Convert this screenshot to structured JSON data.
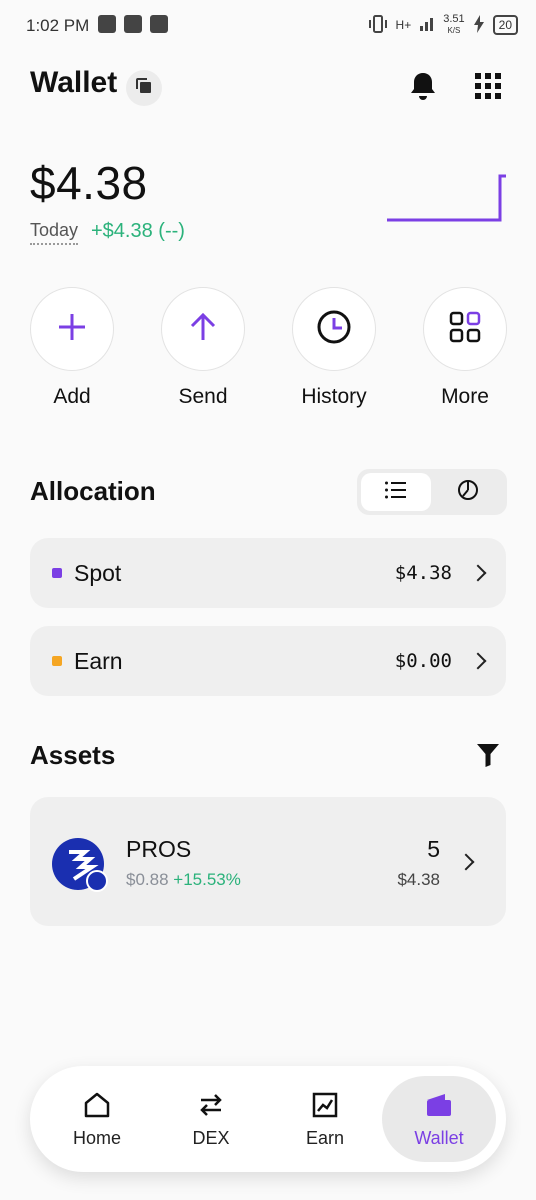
{
  "status_bar": {
    "time": "1:02 PM",
    "network": "H+",
    "speed": "3.51",
    "speed_unit": "K/S",
    "battery": "20"
  },
  "header": {
    "title": "Wallet",
    "icons": [
      "copy-icon",
      "bell-icon",
      "grid-icon"
    ]
  },
  "balance": {
    "amount": "$4.38",
    "period_label": "Today",
    "change": "+$4.38 (--)"
  },
  "actions": [
    {
      "label": "Add",
      "icon": "plus-icon"
    },
    {
      "label": "Send",
      "icon": "arrow-up-icon"
    },
    {
      "label": "History",
      "icon": "clock-icon"
    },
    {
      "label": "More",
      "icon": "apps-icon"
    }
  ],
  "allocation": {
    "title": "Allocation",
    "view_toggle": [
      "list-icon",
      "pie-icon"
    ],
    "rows": [
      {
        "name": "Spot",
        "value": "$4.38",
        "color": "#7b3fe4"
      },
      {
        "name": "Earn",
        "value": "$0.00",
        "color": "#f5a623"
      }
    ]
  },
  "assets": {
    "title": "Assets",
    "items": [
      {
        "symbol": "PROS",
        "price": "$0.88",
        "change": "+15.53%",
        "quantity": "5",
        "value": "$4.38"
      }
    ]
  },
  "nav": {
    "items": [
      {
        "label": "Home",
        "icon": "home-icon"
      },
      {
        "label": "DEX",
        "icon": "swap-icon"
      },
      {
        "label": "Earn",
        "icon": "chart-icon"
      },
      {
        "label": "Wallet",
        "icon": "wallet-icon",
        "active": true
      }
    ]
  },
  "colors": {
    "accent": "#7b3fe4",
    "positive": "#2bb27b",
    "earn_dot": "#f5a623"
  }
}
